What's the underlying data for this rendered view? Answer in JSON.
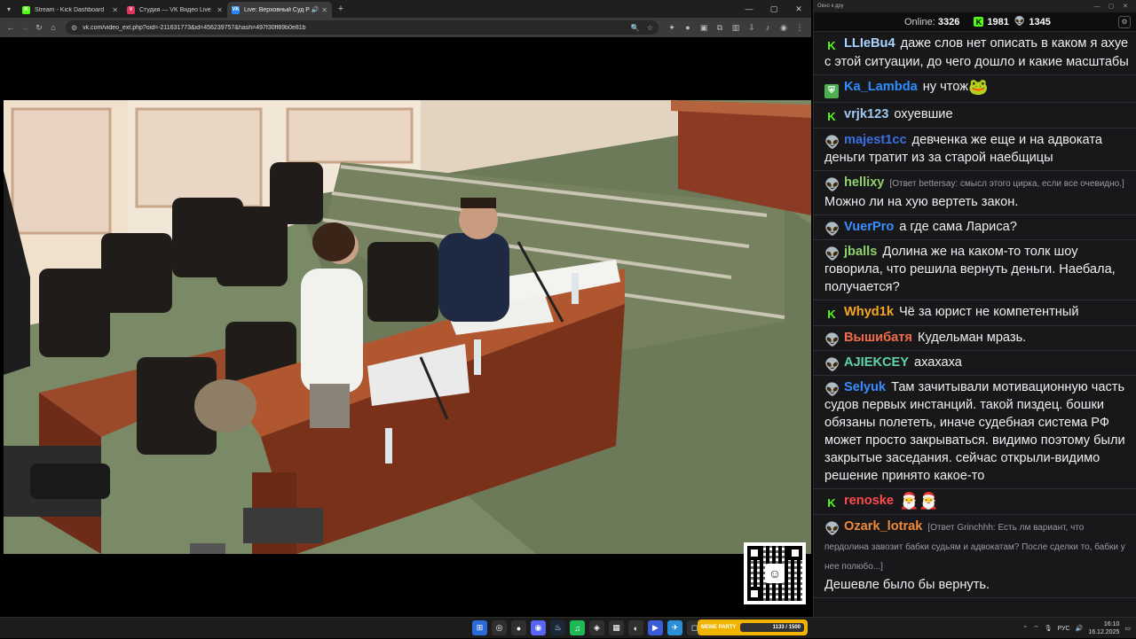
{
  "browser": {
    "tabs": [
      {
        "label": "Stream - Kick Dashboard",
        "favicon": "K",
        "color": "#53fc18",
        "active": false
      },
      {
        "label": "Студия — VK Видео Live",
        "favicon": "V",
        "color": "#e2335a",
        "active": false
      },
      {
        "label": "Live: Верховный Суд Росси",
        "favicon": "VK",
        "color": "#2787f5",
        "active": true
      }
    ],
    "url": "vk.com/video_ext.php?oid=-211631773&id=456239757&hash=497f30ff89b0e81b"
  },
  "chat_window": {
    "title": "Окно к дру",
    "online_label": "Online:",
    "online_count": "3326",
    "kick_count": "1981",
    "vk_count": "1345"
  },
  "messages": [
    {
      "platform": "kick",
      "user": "LLIeBu4",
      "color": "#aad4ff",
      "text": "даже слов нет описать в каком я ахуе с этой ситуации, до чего дошло и какие масштабы"
    },
    {
      "platform": "shield",
      "user": "Ka_Lambda",
      "color": "#2f8cff",
      "text": "ну чтож",
      "emote": "🐸"
    },
    {
      "platform": "kick",
      "user": "vrjk123",
      "color": "#a0c8f0",
      "text": "охуевшие"
    },
    {
      "platform": "vk",
      "user": "majest1cc",
      "color": "#3a6fe0",
      "text": "девченка же еще и на адвоката деньги тратит из за старой наебщицы"
    },
    {
      "platform": "vk",
      "user": "hellixy",
      "color": "#8fd16a",
      "reply": "[Ответ bettersay: смысл этого цирка, если все очевидно.]",
      "text": "Можно ли на хую вертеть закон."
    },
    {
      "platform": "vk",
      "user": "VuerPro",
      "color": "#3a8dff",
      "text": "а где сама Лариса?"
    },
    {
      "platform": "vk",
      "user": "jballs",
      "color": "#8fd16a",
      "text": "Долина же на каком-то толк шоу говорила, что решила вернуть деньги. Наебала, получается?"
    },
    {
      "platform": "kick",
      "user": "Whyd1k",
      "color": "#f6a623",
      "text": "Чё за юрист не компетентный"
    },
    {
      "platform": "vk",
      "user": "Вышибатя",
      "color": "#f36b4a",
      "text": "Кудельман мразь."
    },
    {
      "platform": "vk",
      "user": "AJIEKCEY",
      "color": "#5fd3a8",
      "text": "ахахаха"
    },
    {
      "platform": "vk",
      "user": "Selyuk",
      "color": "#3a8dff",
      "text": "Там зачитывали мотивационную часть судов первых инстанций. такой пиздец. бошки обязаны полететь, иначе судебная система РФ может просто закрываться. видимо поэтому были закрытые заседания. сейчас открыли-видимо решение принято какое-то"
    },
    {
      "platform": "kick",
      "user": "renoske",
      "color": "#ff4b4b",
      "text": "",
      "emote": "🎅🎅"
    },
    {
      "platform": "vk",
      "user": "Ozark_lotrak",
      "color": "#f08a3a",
      "reply": "[Ответ Grinchhh: Есть лм вариант, что пердолина завозит бабки судьям и адвокатам? После сделки то, бабки у нее полюбо...]",
      "text": "Дешевле было бы вернуть."
    }
  ],
  "taskbar": {
    "widget_label": "MEME PARTY",
    "widget_progress": "1133 / 1500",
    "lang": "РУС",
    "time": "16:10",
    "date": "16.12.2025"
  }
}
